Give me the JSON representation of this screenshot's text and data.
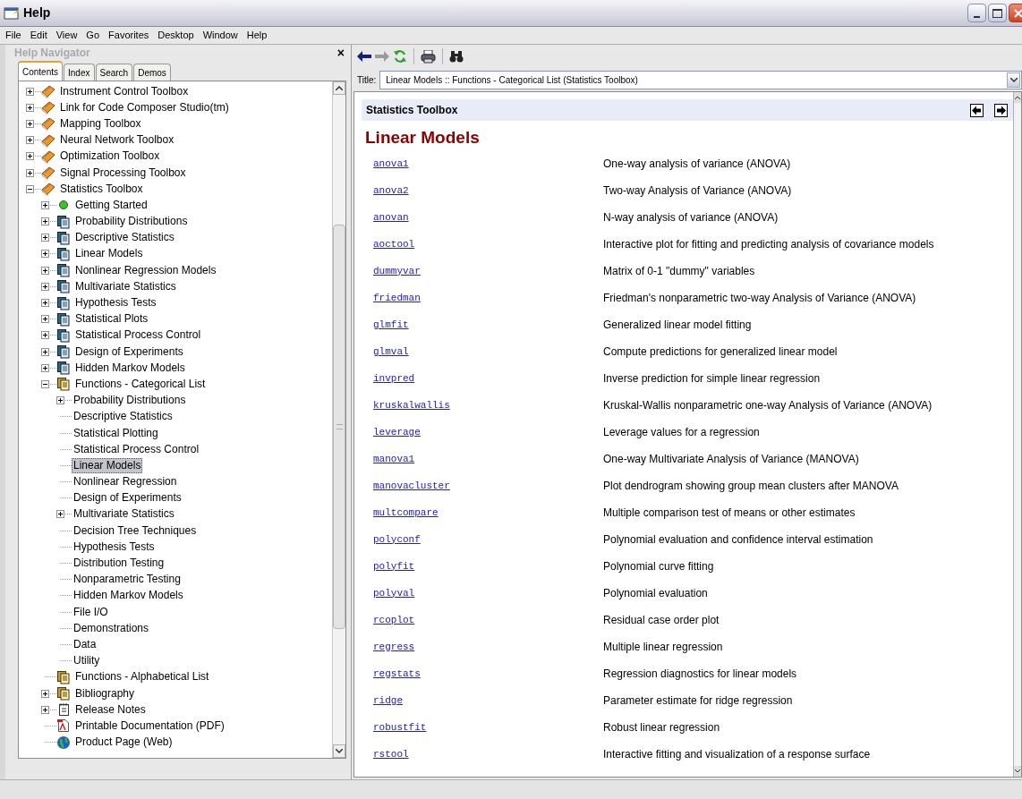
{
  "window": {
    "title": "Help"
  },
  "menu": [
    "File",
    "Edit",
    "View",
    "Go",
    "Favorites",
    "Desktop",
    "Window",
    "Help"
  ],
  "navigator": {
    "title": "Help Navigator",
    "close": "×",
    "tabs": [
      {
        "label": "Contents",
        "selected": true
      },
      {
        "label": "Index",
        "selected": false
      },
      {
        "label": "Search",
        "selected": false
      },
      {
        "label": "Demos",
        "selected": false
      }
    ],
    "tree": [
      {
        "label": "Instrument Control Toolbox",
        "kind": "book",
        "expanded": false,
        "selected": false
      },
      {
        "label": "Link for Code Composer Studio(tm)",
        "kind": "book",
        "expanded": false,
        "selected": false
      },
      {
        "label": "Mapping Toolbox",
        "kind": "book",
        "expanded": false,
        "selected": false
      },
      {
        "label": "Neural Network Toolbox",
        "kind": "book",
        "expanded": false,
        "selected": false
      },
      {
        "label": "Optimization Toolbox",
        "kind": "book",
        "expanded": false,
        "selected": false
      },
      {
        "label": "Signal Processing Toolbox",
        "kind": "book",
        "expanded": false,
        "selected": false
      },
      {
        "label": "Statistics Toolbox",
        "kind": "book",
        "expanded": true,
        "selected": false,
        "children": [
          {
            "label": "Getting Started",
            "kind": "dot",
            "expanded": false,
            "selected": false
          },
          {
            "label": "Probability Distributions",
            "kind": "pages",
            "expanded": false,
            "selected": false
          },
          {
            "label": "Descriptive Statistics",
            "kind": "pages",
            "expanded": false,
            "selected": false
          },
          {
            "label": "Linear Models",
            "kind": "pages",
            "expanded": false,
            "selected": false
          },
          {
            "label": "Nonlinear Regression Models",
            "kind": "pages",
            "expanded": false,
            "selected": false
          },
          {
            "label": "Multivariate Statistics",
            "kind": "pages",
            "expanded": false,
            "selected": false
          },
          {
            "label": "Hypothesis Tests",
            "kind": "pages",
            "expanded": false,
            "selected": false
          },
          {
            "label": "Statistical Plots",
            "kind": "pages",
            "expanded": false,
            "selected": false
          },
          {
            "label": "Statistical Process Control",
            "kind": "pages",
            "expanded": false,
            "selected": false
          },
          {
            "label": "Design of Experiments",
            "kind": "pages",
            "expanded": false,
            "selected": false
          },
          {
            "label": "Hidden Markov Models",
            "kind": "pages",
            "expanded": false,
            "selected": false
          },
          {
            "label": "Functions - Categorical List",
            "kind": "list",
            "expanded": true,
            "selected": false,
            "children": [
              {
                "label": "Probability Distributions",
                "expanded": false,
                "selected": false
              },
              {
                "label": "Descriptive Statistics",
                "selected": false
              },
              {
                "label": "Statistical Plotting",
                "selected": false
              },
              {
                "label": "Statistical Process Control",
                "selected": false
              },
              {
                "label": "Linear Models",
                "selected": true
              },
              {
                "label": "Nonlinear Regression",
                "selected": false
              },
              {
                "label": "Design of Experiments",
                "selected": false
              },
              {
                "label": "Multivariate Statistics",
                "expanded": false,
                "selected": false
              },
              {
                "label": "Decision Tree Techniques",
                "selected": false
              },
              {
                "label": "Hypothesis Tests",
                "selected": false
              },
              {
                "label": "Distribution Testing",
                "selected": false
              },
              {
                "label": "Nonparametric Testing",
                "selected": false
              },
              {
                "label": "Hidden Markov Models",
                "selected": false
              },
              {
                "label": "File I/O",
                "selected": false
              },
              {
                "label": "Demonstrations",
                "selected": false
              },
              {
                "label": "Data",
                "selected": false
              },
              {
                "label": "Utility",
                "selected": false
              }
            ]
          },
          {
            "label": "Functions - Alphabetical List",
            "kind": "list",
            "selected": false
          },
          {
            "label": "Bibliography",
            "kind": "list",
            "expanded": false,
            "selected": false
          },
          {
            "label": "Release Notes",
            "kind": "notes",
            "expanded": false,
            "selected": false
          },
          {
            "label": "Printable Documentation (PDF)",
            "kind": "pdf",
            "selected": false
          },
          {
            "label": "Product Page (Web)",
            "kind": "globe",
            "selected": false
          }
        ]
      }
    ]
  },
  "viewer": {
    "title_label": "Title:",
    "title_value": "Linear Models :: Functions - Categorical List (Statistics Toolbox)",
    "toolbox": "Statistics Toolbox",
    "heading": "Linear Models",
    "functions": [
      {
        "name": "anova1",
        "description": "One-way analysis of variance (ANOVA)"
      },
      {
        "name": "anova2",
        "description": "Two-way Analysis of Variance (ANOVA)"
      },
      {
        "name": "anovan",
        "description": "N-way analysis of variance (ANOVA)"
      },
      {
        "name": "aoctool",
        "description": "Interactive plot for fitting and predicting analysis of covariance models"
      },
      {
        "name": "dummyvar",
        "description": "Matrix of 0-1 \"dummy\" variables"
      },
      {
        "name": "friedman",
        "description": "Friedman's nonparametric two-way Analysis of Variance (ANOVA)"
      },
      {
        "name": "glmfit",
        "description": "Generalized linear model fitting"
      },
      {
        "name": "glmval",
        "description": "Compute predictions for generalized linear model"
      },
      {
        "name": "invpred",
        "description": "Inverse prediction for simple linear regression"
      },
      {
        "name": "kruskalwallis",
        "description": "Kruskal-Wallis nonparametric one-way Analysis of Variance (ANOVA)"
      },
      {
        "name": "leverage",
        "description": "Leverage values for a regression"
      },
      {
        "name": "manova1",
        "description": "One-way Multivariate Analysis of Variance (MANOVA)"
      },
      {
        "name": "manovacluster",
        "description": "Plot dendrogram showing group mean clusters after MANOVA"
      },
      {
        "name": "multcompare",
        "description": "Multiple comparison test of means or other estimates"
      },
      {
        "name": "polyconf",
        "description": "Polynomial evaluation and confidence interval estimation"
      },
      {
        "name": "polyfit",
        "description": "Polynomial curve fitting"
      },
      {
        "name": "polyval",
        "description": "Polynomial evaluation"
      },
      {
        "name": "rcoplot",
        "description": "Residual case order plot"
      },
      {
        "name": "regress",
        "description": "Multiple linear regression"
      },
      {
        "name": "regstats",
        "description": "Regression diagnostics for linear models"
      },
      {
        "name": "ridge",
        "description": "Parameter estimate for ridge regression"
      },
      {
        "name": "robustfit",
        "description": "Robust linear regression"
      },
      {
        "name": "rstool",
        "description": "Interactive fitting and visualization of a response surface"
      }
    ]
  }
}
